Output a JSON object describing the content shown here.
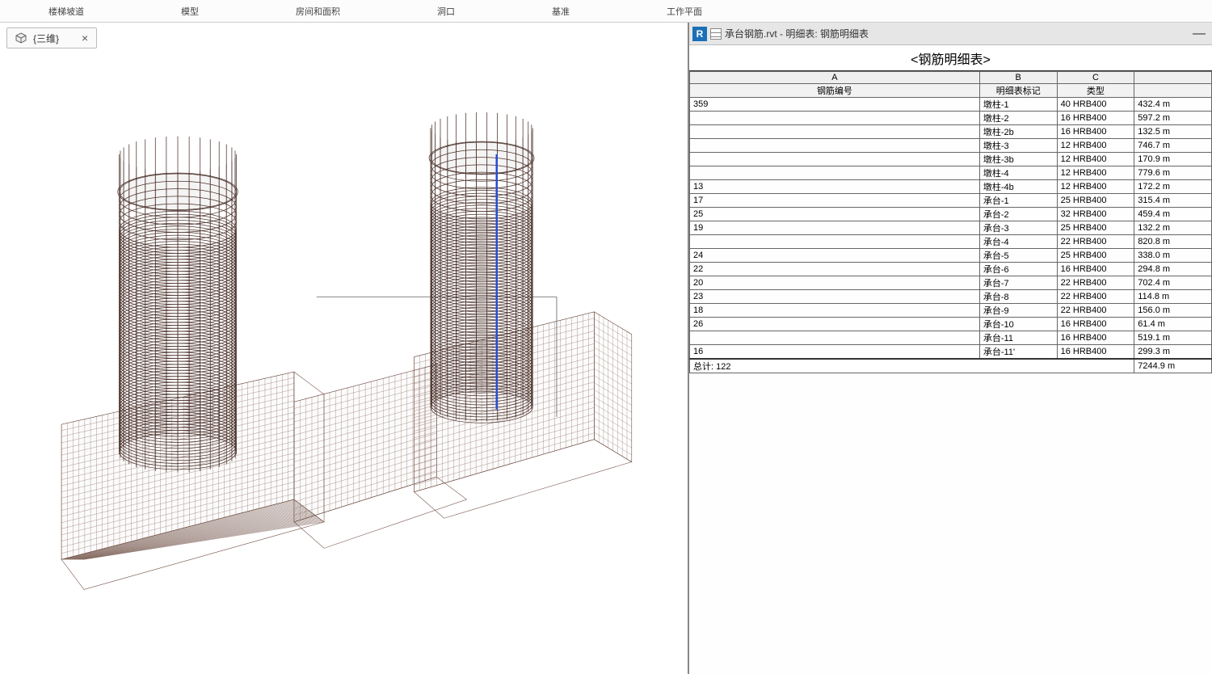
{
  "ribbon": {
    "items": [
      "楼梯坡道",
      "模型",
      "房间和面积",
      "洞口",
      "基准",
      "工作平面"
    ]
  },
  "view_tab": {
    "label": "{三维}",
    "close": "×"
  },
  "schedule": {
    "titlebar": "承台钢筋.rvt - 明细表: 钢筋明细表",
    "title": "<钢筋明细表>",
    "col_letters": [
      "A",
      "B",
      "C",
      ""
    ],
    "headers": [
      "钢筋编号",
      "明细表标记",
      "类型",
      ""
    ],
    "rows": [
      {
        "a": "359",
        "b": "墩柱-1",
        "c": "40 HRB400",
        "d": "432.4 m"
      },
      {
        "a": "",
        "b": "墩柱-2",
        "c": "16 HRB400",
        "d": "597.2 m"
      },
      {
        "a": "",
        "b": "墩柱-2b",
        "c": "16 HRB400",
        "d": "132.5 m"
      },
      {
        "a": "",
        "b": "墩柱-3",
        "c": "12 HRB400",
        "d": "746.7 m"
      },
      {
        "a": "",
        "b": "墩柱-3b",
        "c": "12 HRB400",
        "d": "170.9 m"
      },
      {
        "a": "",
        "b": "墩柱-4",
        "c": "12 HRB400",
        "d": "779.6 m"
      },
      {
        "a": "13",
        "b": "墩柱-4b",
        "c": "12 HRB400",
        "d": "172.2 m"
      },
      {
        "a": "17",
        "b": "承台-1",
        "c": "25 HRB400",
        "d": "315.4 m"
      },
      {
        "a": "25",
        "b": "承台-2",
        "c": "32 HRB400",
        "d": "459.4 m"
      },
      {
        "a": "19",
        "b": "承台-3",
        "c": "25 HRB400",
        "d": "132.2 m"
      },
      {
        "a": "",
        "b": "承台-4",
        "c": "22 HRB400",
        "d": "820.8 m"
      },
      {
        "a": "24",
        "b": "承台-5",
        "c": "25 HRB400",
        "d": "338.0 m"
      },
      {
        "a": "22",
        "b": "承台-6",
        "c": "16 HRB400",
        "d": "294.8 m"
      },
      {
        "a": "20",
        "b": "承台-7",
        "c": "22 HRB400",
        "d": "702.4 m"
      },
      {
        "a": "23",
        "b": "承台-8",
        "c": "22 HRB400",
        "d": "114.8 m"
      },
      {
        "a": "18",
        "b": "承台-9",
        "c": "22 HRB400",
        "d": "156.0 m"
      },
      {
        "a": "26",
        "b": "承台-10",
        "c": "16 HRB400",
        "d": "61.4 m"
      },
      {
        "a": "",
        "b": "承台-11",
        "c": "16 HRB400",
        "d": "519.1 m"
      },
      {
        "a": "16",
        "b": "承台-11'",
        "c": "16 HRB400",
        "d": "299.3 m"
      }
    ],
    "total": {
      "label": "总计: 122",
      "value": "7244.9 m"
    }
  }
}
